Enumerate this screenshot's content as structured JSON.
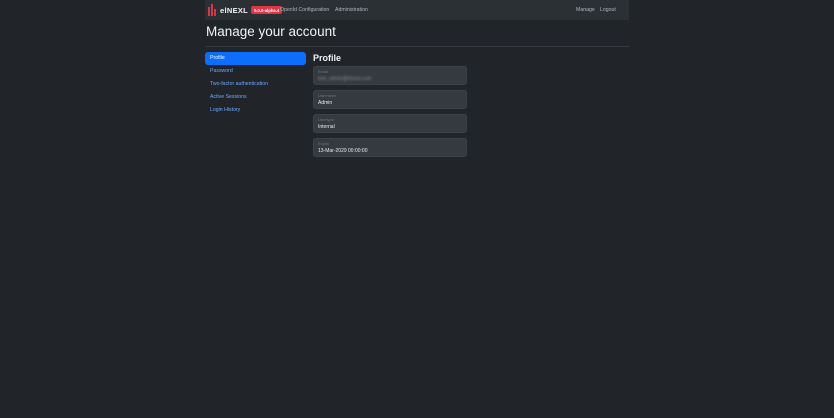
{
  "header": {
    "brand": "elNEXL",
    "version": "5.0.0-alpha.4",
    "nav_left": [
      "OpenId Configuration",
      "Administration"
    ],
    "nav_right": [
      "Manage",
      "Logout"
    ]
  },
  "page_title": "Manage your account",
  "sidebar": {
    "items": [
      {
        "label": "Profile",
        "active": true
      },
      {
        "label": "Password"
      },
      {
        "label": "Two-factor authentication"
      },
      {
        "label": "Active Sessions"
      },
      {
        "label": "Login History"
      }
    ]
  },
  "profile": {
    "title": "Profile",
    "fields": [
      {
        "label": "Email",
        "value": "test_admin@elnexl.com",
        "blurred": true
      },
      {
        "label": "Username",
        "value": "Admin"
      },
      {
        "label": "Usertype",
        "value": "Internal"
      },
      {
        "label": "Expiry",
        "value": "13-Mar-2029 00:00:00"
      }
    ]
  },
  "colors": {
    "background": "#212529",
    "navbar": "#2b3035",
    "accent": "#0d6efd",
    "link": "#6ea8fe",
    "badge": "#dc3545"
  }
}
